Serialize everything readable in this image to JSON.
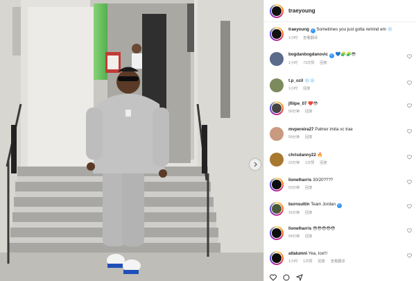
{
  "post": {
    "author": "traeyoung",
    "caption_user": "traeyoung",
    "caption_text": "Sometimes you just gotta remind em",
    "caption_emoji": "❄️",
    "caption_time": "1小时",
    "caption_translate": "查看翻译"
  },
  "reply_label": "回复",
  "comments": [
    {
      "user": "bogdanbogdanovic",
      "text": "💙🧩🧩😳",
      "time": "1小时",
      "likes": "73次赞",
      "verified": true
    },
    {
      "user": "t.p_ozil",
      "text": "❄️❄️",
      "time": "1小时",
      "likes": "",
      "verified": false
    },
    {
      "user": "jfilipe_07",
      "text": "❤️😳",
      "time": "59分钟",
      "likes": "",
      "verified": false
    },
    {
      "user": "mvpereira27",
      "text": "Palmer imita vc trae",
      "time": "59分钟",
      "likes": "",
      "verified": false
    },
    {
      "user": "chrisdanny22",
      "text": "🔥",
      "time": "23分钟",
      "likes": "1次赞",
      "verified": false
    },
    {
      "user": "lionelharris",
      "text": "30/20????",
      "time": "53分钟",
      "likes": "",
      "verified": false
    },
    {
      "user": "burnsuttin",
      "text": "Team Jordan",
      "time": "16分钟",
      "likes": "",
      "verified": true
    },
    {
      "user": "lionelharris",
      "text": "😳😳😳😳😳",
      "time": "54分钟",
      "likes": "",
      "verified": false
    },
    {
      "user": "atlalumni",
      "text": "Yea, Ice!!!",
      "time": "1小时",
      "likes": "1次赞",
      "verified": false,
      "translate": "查看翻译"
    }
  ],
  "colors": {
    "accent_blue": "#3897f0",
    "story_ring": "#d62976",
    "muted": "#8e8e8e"
  }
}
